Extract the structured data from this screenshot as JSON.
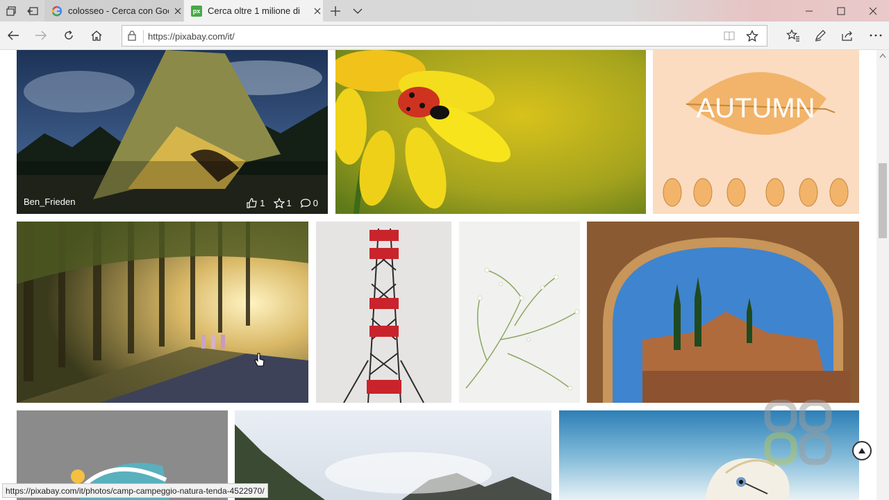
{
  "browser": {
    "tabs": [
      {
        "title": "colosseo - Cerca con Googl",
        "icon": "google-icon",
        "active": false
      },
      {
        "title": "Cerca oltre 1 milione di",
        "icon": "pixabay-icon",
        "active": true
      }
    ],
    "favicon_text": "px",
    "url": "https://pixabay.com/it/",
    "status_url": "https://pixabay.com/it/photos/camp-campeggio-natura-tenda-4522970/"
  },
  "gallery": {
    "hovered_photo": {
      "author": "Ben_Frieden",
      "likes": "1",
      "favorites": "1",
      "comments": "0"
    },
    "autumn_text": "AUTUMN"
  },
  "colors": {
    "tabstrip": "#d7d7d7",
    "active_tab": "#f2f2f2",
    "pixabay_green": "#48a947"
  }
}
